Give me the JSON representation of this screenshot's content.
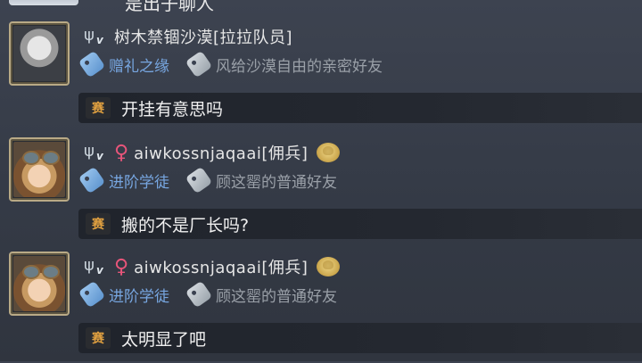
{
  "top_partial": {
    "text": "是出子聊人"
  },
  "messages": [
    {
      "username": "树木禁锢沙漠[拉拉队员]",
      "gender": "",
      "has_group_badge": false,
      "avatar": "silver-hair-avatar",
      "relation": "赠礼之缘",
      "friend_label": "风给沙漠自由的亲密好友",
      "server_badge": "赛",
      "text": "开挂有意思吗"
    },
    {
      "username": "aiwkossnjaqaai[佣兵]",
      "gender": "♀",
      "has_group_badge": true,
      "avatar": "goggles-avatar",
      "relation": "进阶学徒",
      "friend_label": "顾这罂的普通好友",
      "server_badge": "赛",
      "text": "搬的不是厂长吗?"
    },
    {
      "username": "aiwkossnjaqaai[佣兵]",
      "gender": "♀",
      "has_group_badge": true,
      "avatar": "goggles-avatar",
      "relation": "进阶学徒",
      "friend_label": "顾这罂的普通好友",
      "server_badge": "赛",
      "text": "太明显了吧"
    }
  ],
  "colors": {
    "background": "#353b47",
    "relation": "#77a6e0",
    "friend": "#9aa0a8",
    "gender": "#e8557a",
    "server_badge": "#e0a040"
  }
}
